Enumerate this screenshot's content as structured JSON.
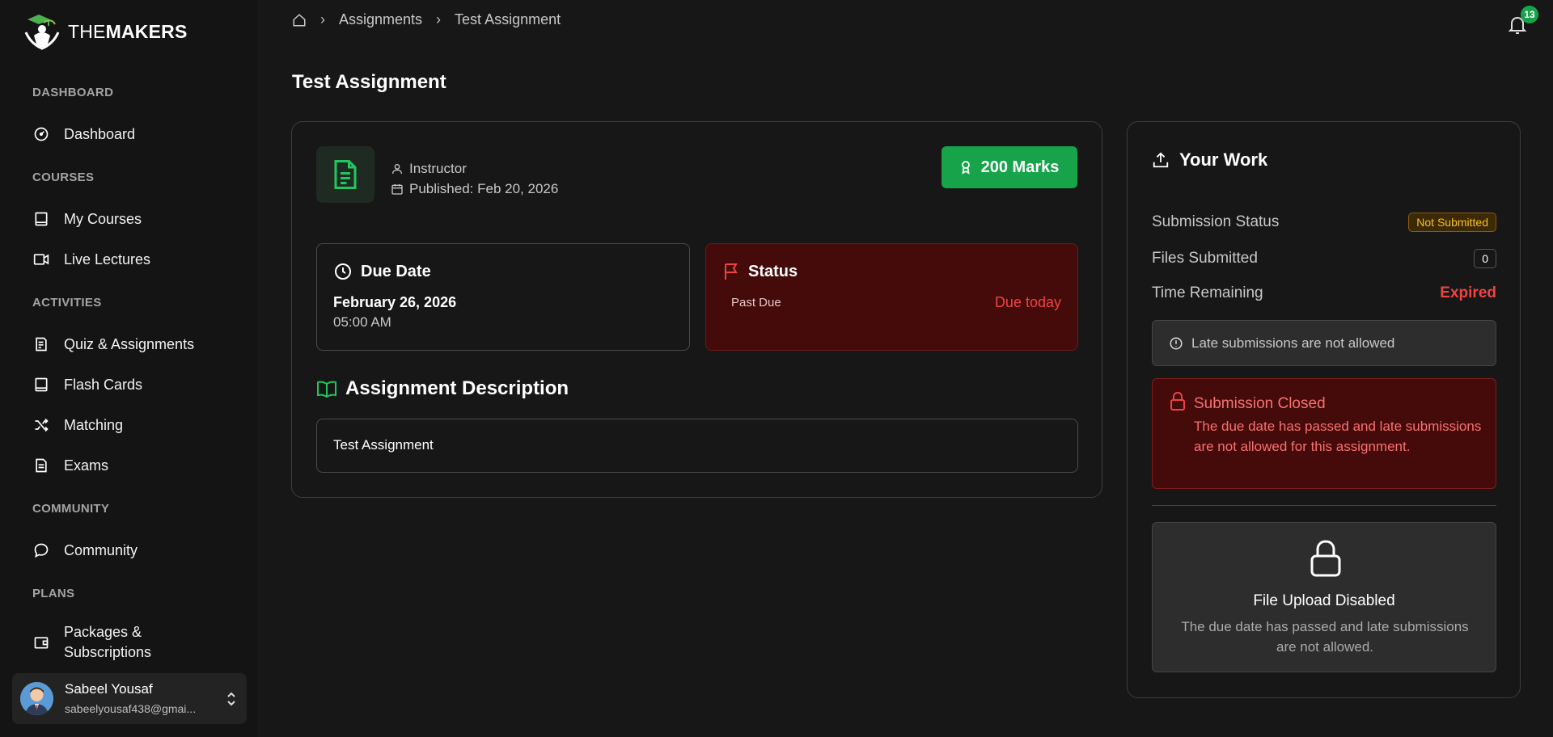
{
  "app": {
    "logo_the": "THE",
    "logo_makers": "MAKERS"
  },
  "sidebar": {
    "sections": [
      {
        "label": "DASHBOARD",
        "items": [
          {
            "label": "Dashboard",
            "icon": "gauge-icon"
          }
        ]
      },
      {
        "label": "COURSES",
        "items": [
          {
            "label": "My Courses",
            "icon": "book-icon"
          },
          {
            "label": "Live Lectures",
            "icon": "video-icon"
          }
        ]
      },
      {
        "label": "ACTIVITIES",
        "items": [
          {
            "label": "Quiz & Assignments",
            "icon": "clipboard-icon"
          },
          {
            "label": "Flash Cards",
            "icon": "cards-icon"
          },
          {
            "label": "Matching",
            "icon": "shuffle-icon"
          },
          {
            "label": "Exams",
            "icon": "file-icon"
          }
        ]
      },
      {
        "label": "COMMUNITY",
        "items": [
          {
            "label": "Community",
            "icon": "chat-icon"
          }
        ]
      },
      {
        "label": "PLANS",
        "items": [
          {
            "label_line1": "Packages &",
            "label_line2": "Subscriptions",
            "icon": "wallet-icon"
          }
        ]
      }
    ],
    "user": {
      "name": "Sabeel Yousaf",
      "email": "sabeelyousaf438@gmai..."
    }
  },
  "header": {
    "breadcrumb": [
      "Assignments",
      "Test Assignment"
    ],
    "notification_count": "13"
  },
  "page": {
    "title": "Test Assignment"
  },
  "assignment": {
    "instructor": "Instructor",
    "published": "Published: Feb 20, 2026",
    "marks": "200 Marks",
    "due_title": "Due Date",
    "due_date": "February 26, 2026",
    "due_time": "05:00 AM",
    "status_title": "Status",
    "status_label": "Past Due",
    "status_value": "Due today",
    "description_title": "Assignment Description",
    "description": "Test Assignment"
  },
  "your_work": {
    "title": "Your Work",
    "submission_status_label": "Submission Status",
    "submission_status": "Not Submitted",
    "files_label": "Files Submitted",
    "files_count": "0",
    "time_label": "Time Remaining",
    "time_value": "Expired",
    "late_notice": "Late submissions are not allowed",
    "closed_title": "Submission Closed",
    "closed_text": "The due date has passed and late submissions are not allowed for this assignment.",
    "upload_title": "File Upload Disabled",
    "upload_text": "The due date has passed and late submissions are not allowed."
  },
  "colors": {
    "accent": "#16a34a",
    "danger": "#ef4444",
    "danger_bg": "#450a0a",
    "warning": "#fbbf24"
  }
}
